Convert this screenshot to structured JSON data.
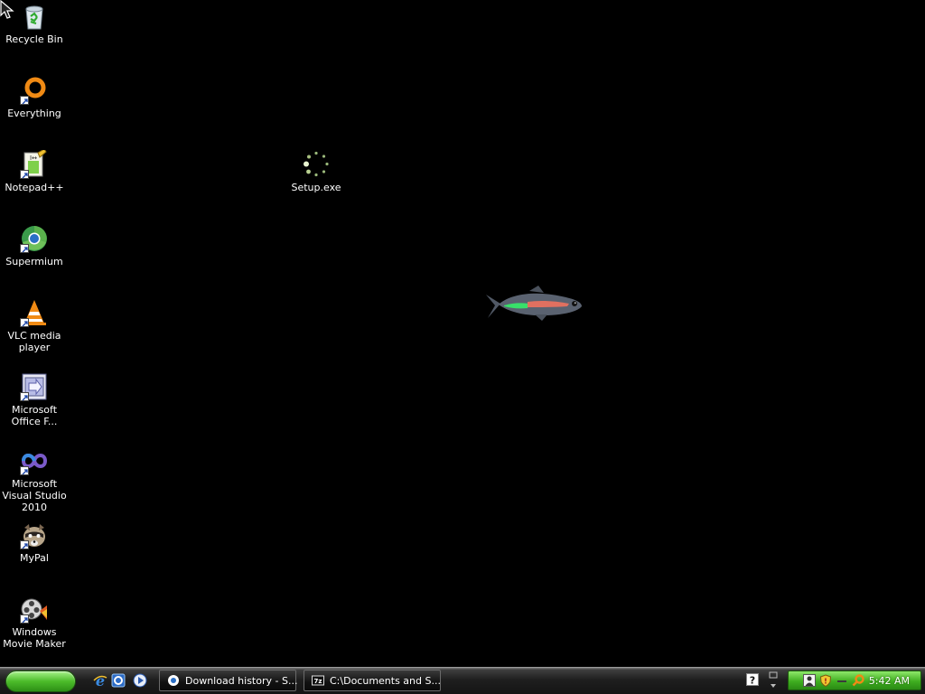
{
  "desktop": {
    "icons": [
      {
        "label": "Recycle Bin",
        "icon": "recycle-bin-icon"
      },
      {
        "label": "Everything",
        "icon": "everything-icon"
      },
      {
        "label": "Notepad++",
        "icon": "notepad-plus-plus-icon"
      },
      {
        "label": "Supermium",
        "icon": "supermium-icon"
      },
      {
        "label": "VLC media player",
        "icon": "vlc-icon"
      },
      {
        "label": "Microsoft Office F...",
        "icon": "office-icon"
      },
      {
        "label": "Microsoft Visual Studio 2010",
        "icon": "visual-studio-icon"
      },
      {
        "label": "MyPal",
        "icon": "mypal-icon"
      },
      {
        "label": "Windows Movie Maker",
        "icon": "movie-maker-icon"
      }
    ],
    "setup": {
      "label": "Setup.exe",
      "icon": "loading-spinner-icon"
    }
  },
  "taskbar": {
    "tasks": [
      {
        "label": "Download history - S...",
        "icon": "browser-icon"
      },
      {
        "label": "C:\\Documents and S...",
        "icon": "7zip-icon"
      }
    ],
    "tray": {
      "time": "5:42 AM"
    }
  },
  "colors": {
    "desktop_bg": "#000000",
    "start_green": "#4cbc2a",
    "tray_green": "#3fae20"
  }
}
